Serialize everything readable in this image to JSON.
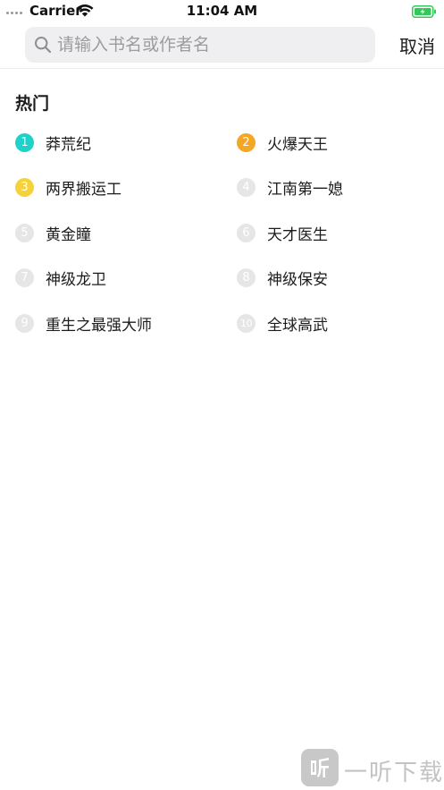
{
  "status_bar": {
    "carrier": "Carrier",
    "time": "11:04 AM",
    "battery_color": "#34c759"
  },
  "search": {
    "placeholder": "请输入书名或作者名",
    "value": "",
    "cancel_label": "取消"
  },
  "hot": {
    "title": "热门",
    "items": [
      {
        "rank": "1",
        "label": "莽荒纪",
        "color": "#1fd1c8"
      },
      {
        "rank": "2",
        "label": "火爆天王",
        "color": "#f5a623"
      },
      {
        "rank": "3",
        "label": "两界搬运工",
        "color": "#f6d23a"
      },
      {
        "rank": "4",
        "label": "江南第一媳",
        "color": "#e6e6e6"
      },
      {
        "rank": "5",
        "label": "黄金瞳",
        "color": "#e6e6e6"
      },
      {
        "rank": "6",
        "label": "天才医生",
        "color": "#e6e6e6"
      },
      {
        "rank": "7",
        "label": "神级龙卫",
        "color": "#e6e6e6"
      },
      {
        "rank": "8",
        "label": "神级保安",
        "color": "#e6e6e6"
      },
      {
        "rank": "9",
        "label": "重生之最强大师",
        "color": "#e6e6e6"
      },
      {
        "rank": "10",
        "label": "全球高武",
        "color": "#e6e6e6"
      }
    ]
  },
  "watermark": {
    "text": "一听下载"
  }
}
